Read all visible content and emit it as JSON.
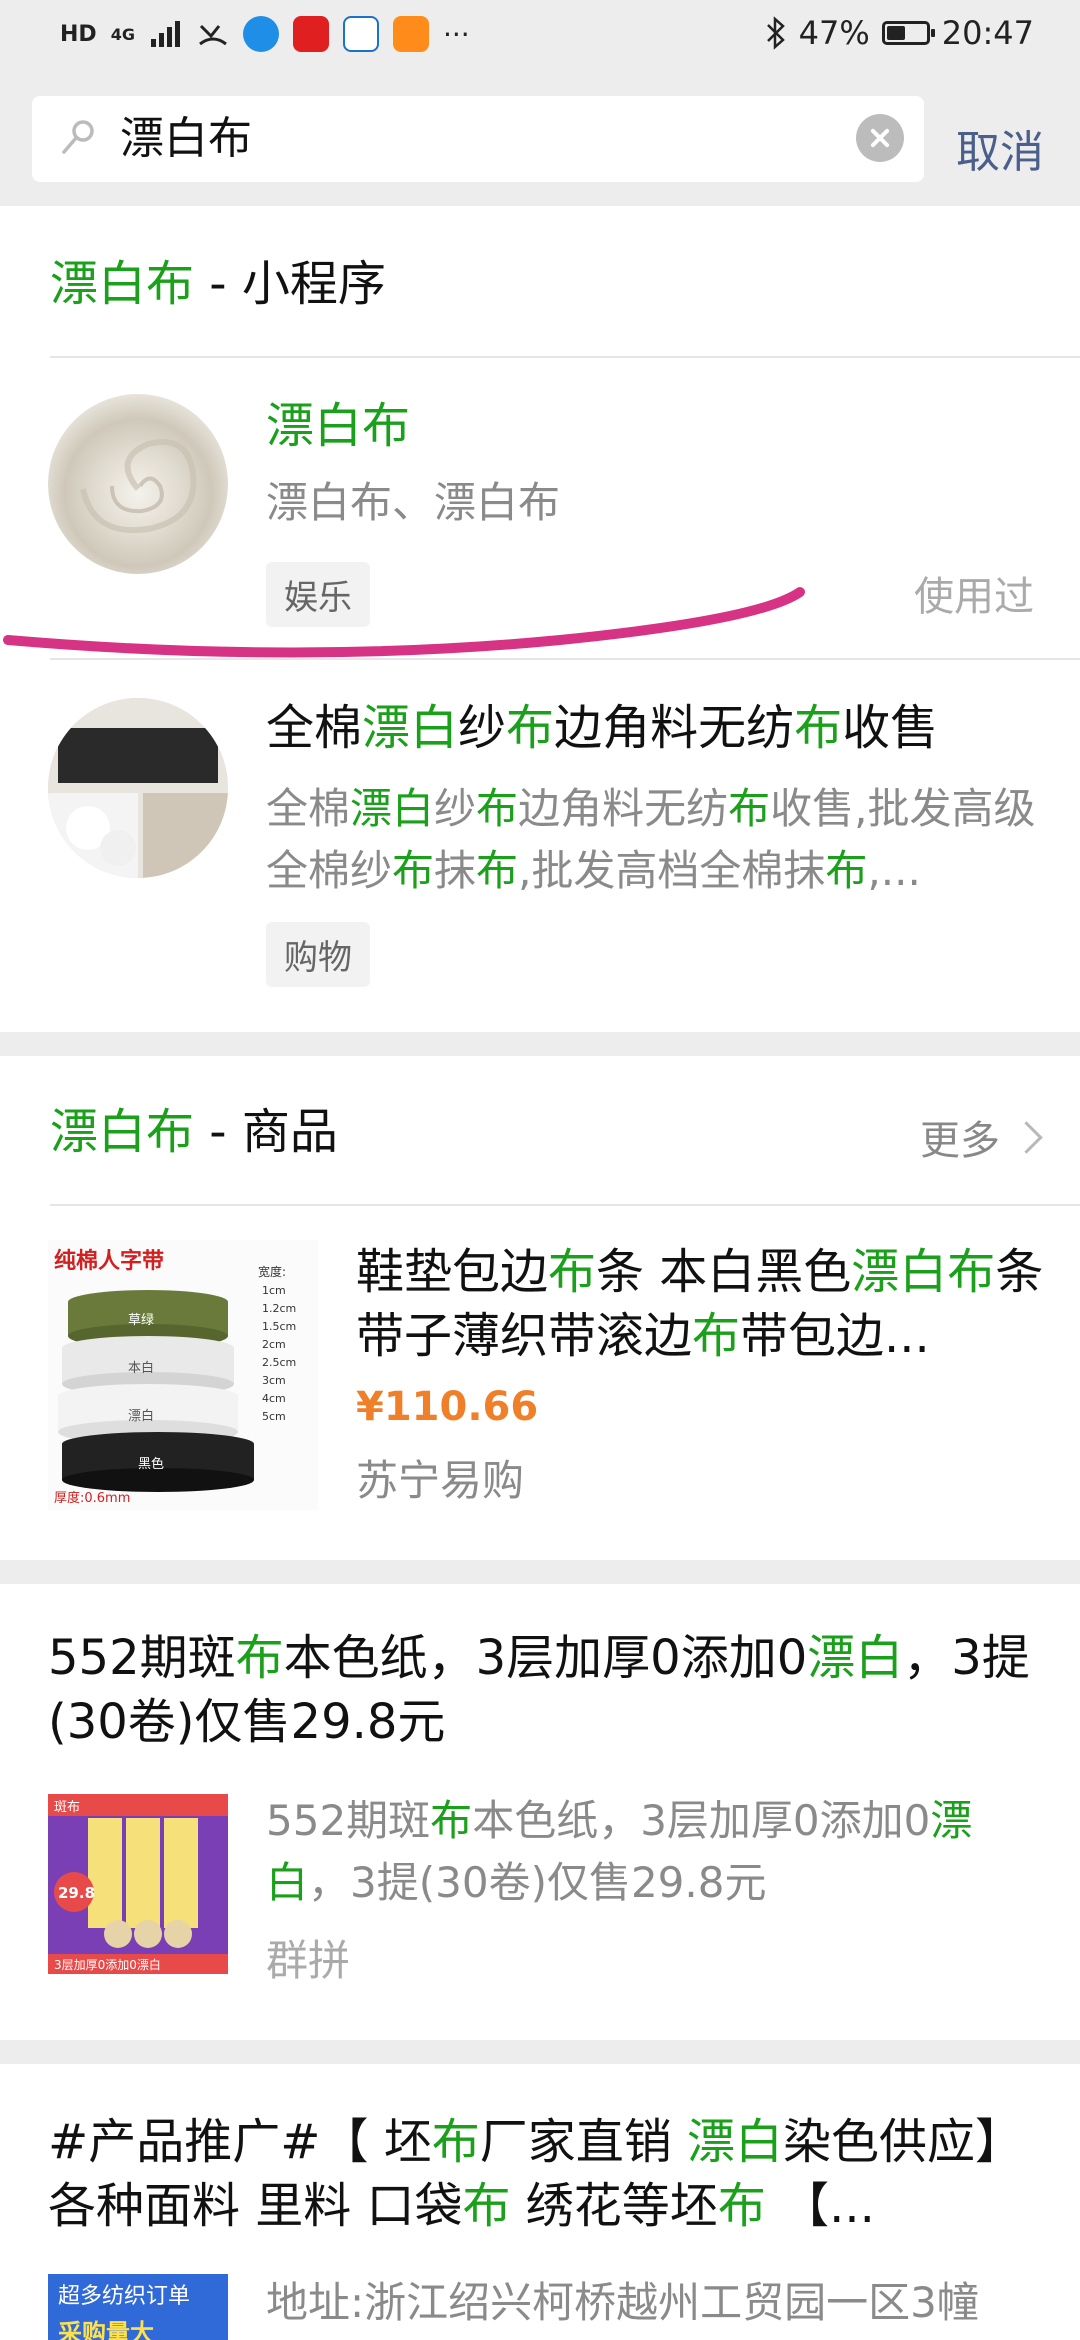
{
  "status_bar": {
    "net_left": "HD",
    "net_mid": "4G",
    "more": "···",
    "battery_pct": "47%",
    "battery_level": 0.47,
    "time": "20:47"
  },
  "search": {
    "query": "漂白布",
    "cancel": "取消"
  },
  "mini_programs": {
    "header_hl": "漂白布",
    "header_rest": " - 小程序",
    "items": [
      {
        "title": "漂白布",
        "desc": "漂白布、漂白布",
        "tag": "娱乐",
        "used": "使用过"
      },
      {
        "title_parts": [
          "全棉",
          "漂白",
          "纱",
          "布",
          "边角料无纺",
          "布",
          "收售"
        ],
        "desc_parts": [
          "全棉",
          "漂白",
          "纱",
          "布",
          "边角料无纺",
          "布",
          "收售,批发高级全棉纱",
          "布",
          "抹",
          "布",
          ",批发高档全棉抹",
          "布",
          ",..."
        ],
        "tag": "购物"
      }
    ]
  },
  "products": {
    "header_hl": "漂白布",
    "header_rest": " - 商品",
    "more": "更多",
    "item": {
      "title_parts": [
        "鞋垫包边",
        "布",
        "条 本白黑色",
        "漂白布",
        "条带子薄织带滚边",
        "布",
        "带包边..."
      ],
      "price": "¥110.66",
      "store": "苏宁易购",
      "thumb_label": "纯棉人字带",
      "thumb_width_label": "宽度:",
      "thumb_sizes": [
        "1cm",
        "1.2cm",
        "1.5cm",
        "2cm",
        "2.5cm",
        "3cm",
        "4cm",
        "5cm"
      ],
      "thumb_colors": [
        "草绿",
        "本白",
        "漂白",
        "黑色"
      ],
      "thumb_thickness": "厚度:0.6mm"
    }
  },
  "post1": {
    "title_parts": [
      "552期斑",
      "布",
      "本色纸，3层加厚0添加0",
      "漂白",
      "，3提(30卷)仅售29.8元"
    ],
    "desc_parts": [
      "552期斑",
      "布",
      "本色纸，3层加厚0添加0",
      "漂白",
      "，3提(30卷)仅售29.8元"
    ],
    "source": "群拼",
    "thumb_top": "斑布",
    "thumb_price": "29.8",
    "thumb_bottom": "3层加厚0添加0漂白"
  },
  "post2": {
    "title_parts": [
      "#产品推广#【 坯",
      "布",
      "厂家直销 ",
      "漂白",
      "染色供应】各种面料 里料 口袋",
      "布",
      " 绣花等坯",
      "布",
      " 【..."
    ],
    "desc": "地址:浙江绍兴柯桥越州工贸园一区3幢",
    "thumb_text": "超多纺织订单",
    "thumb_text2": "采购量大"
  },
  "colors": {
    "highlight": "#1aa01a",
    "link": "#4a5f8a",
    "price": "#f07f2a",
    "annotation": "#d63384"
  }
}
